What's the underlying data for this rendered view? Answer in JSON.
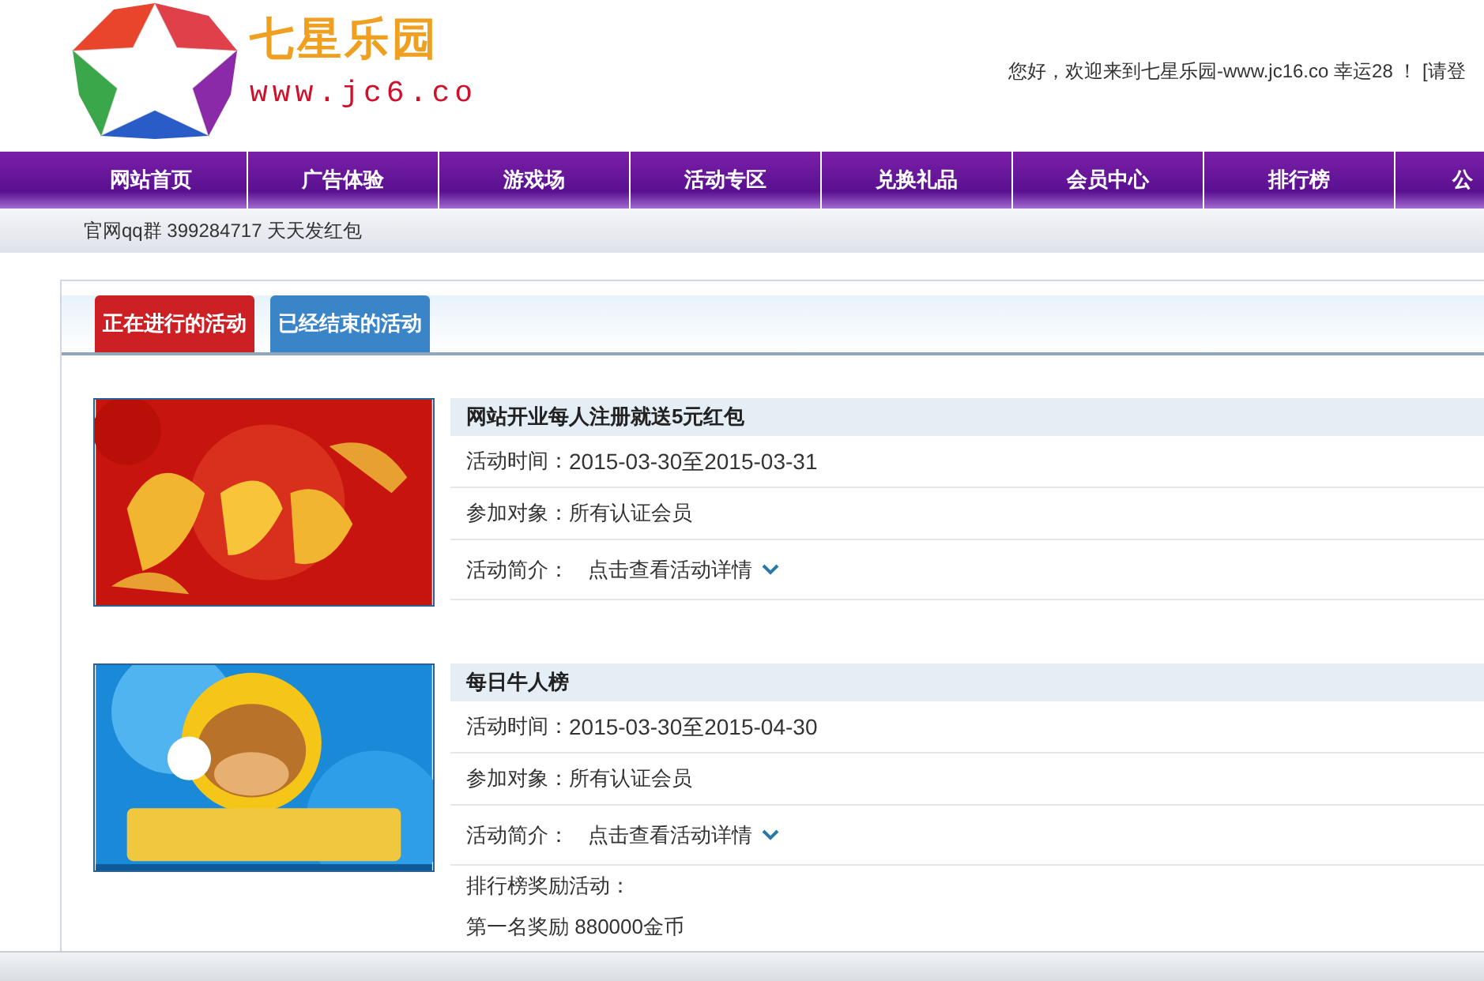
{
  "header": {
    "logo_title": "七星乐园",
    "logo_url": "www.jc6.co",
    "welcome": "您好，欢迎来到七星乐园-www.jc16.co 幸运28 ！ [请登"
  },
  "nav": [
    {
      "label": "网站首页"
    },
    {
      "label": "广告体验"
    },
    {
      "label": "游戏场"
    },
    {
      "label": "活动专区"
    },
    {
      "label": "兑换礼品"
    },
    {
      "label": "会员中心"
    },
    {
      "label": "排行榜"
    },
    {
      "label": "公"
    }
  ],
  "notice": "官网qq群 399284717 天天发红包",
  "tabs": [
    {
      "label": "正在进行的活动",
      "selected": true
    },
    {
      "label": "已经结束的活动",
      "selected": false
    }
  ],
  "activities": [
    {
      "kind": "red",
      "title": "网站开业每人注册就送5元红包",
      "time_label": "活动时间：",
      "time": "2015-03-30至2015-03-31",
      "target_label": "参加对象：",
      "target": "所有认证会员",
      "intro_label": "活动简介：",
      "intro_link": "点击查看活动详情"
    },
    {
      "kind": "blue",
      "title": "每日牛人榜",
      "time_label": "活动时间：",
      "time": "2015-03-30至2015-04-30",
      "target_label": "参加对象：",
      "target": "所有认证会员",
      "intro_label": "活动简介：",
      "intro_link": "点击查看活动详情",
      "details": [
        "排行榜奖励活动：",
        "第一名奖励 880000金币"
      ]
    }
  ]
}
